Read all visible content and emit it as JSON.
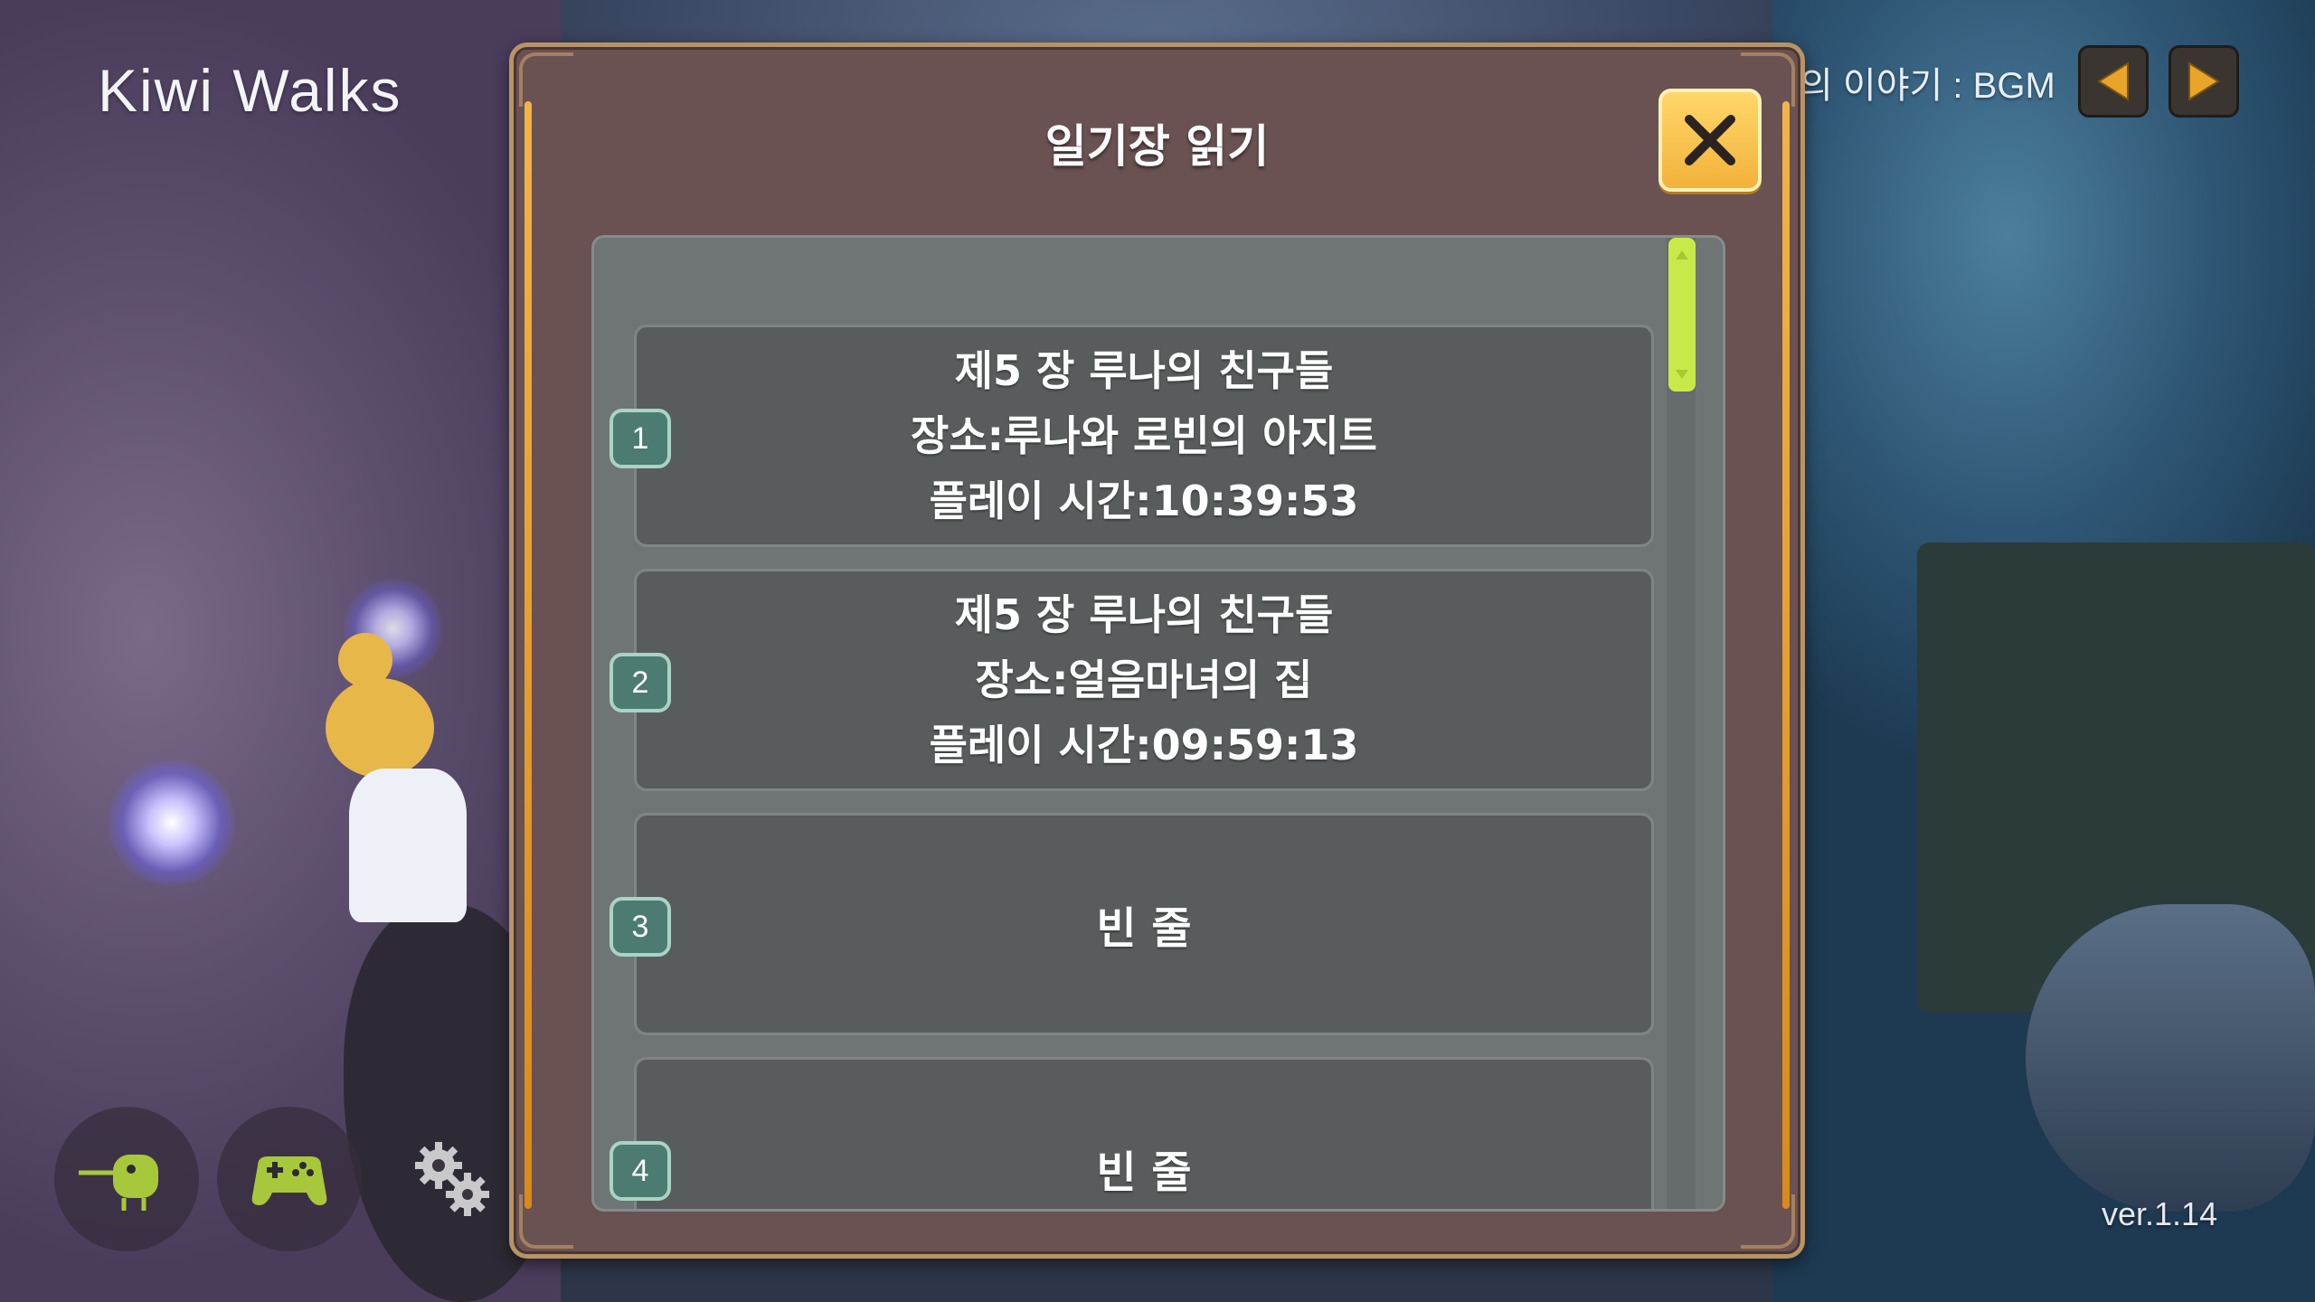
{
  "hud": {
    "logo": "Kiwi Walks",
    "bgm_label": "의 이야기 : BGM",
    "version": "ver.1.14",
    "prev_icon": "triangle-left-icon",
    "next_icon": "triangle-right-icon"
  },
  "bottom_buttons": [
    {
      "icon": "kiwi-bird-icon"
    },
    {
      "icon": "gamepad-icon"
    },
    {
      "icon": "gears-icon"
    }
  ],
  "dialog": {
    "title": "일기장 읽기",
    "close_icon": "close-x-icon",
    "slots": [
      {
        "number": "1",
        "chapter": "제5 장 루나의 친구들",
        "location": "장소:루나와 로빈의 아지트",
        "playtime": "플레이 시간:10:39:53"
      },
      {
        "number": "2",
        "chapter": "제5 장 루나의 친구들",
        "location": "장소:얼음마녀의 집",
        "playtime": "플레이 시간:09:59:13"
      },
      {
        "number": "3",
        "empty_label": "빈 줄"
      },
      {
        "number": "4",
        "empty_label": "빈 줄"
      }
    ]
  },
  "colors": {
    "dialog_bg": "#6a5152",
    "rail": "#f0b44a",
    "scroll_thumb": "#c7ea4a",
    "badge": "#4b7b71",
    "close_btn": "#f3b23a"
  }
}
